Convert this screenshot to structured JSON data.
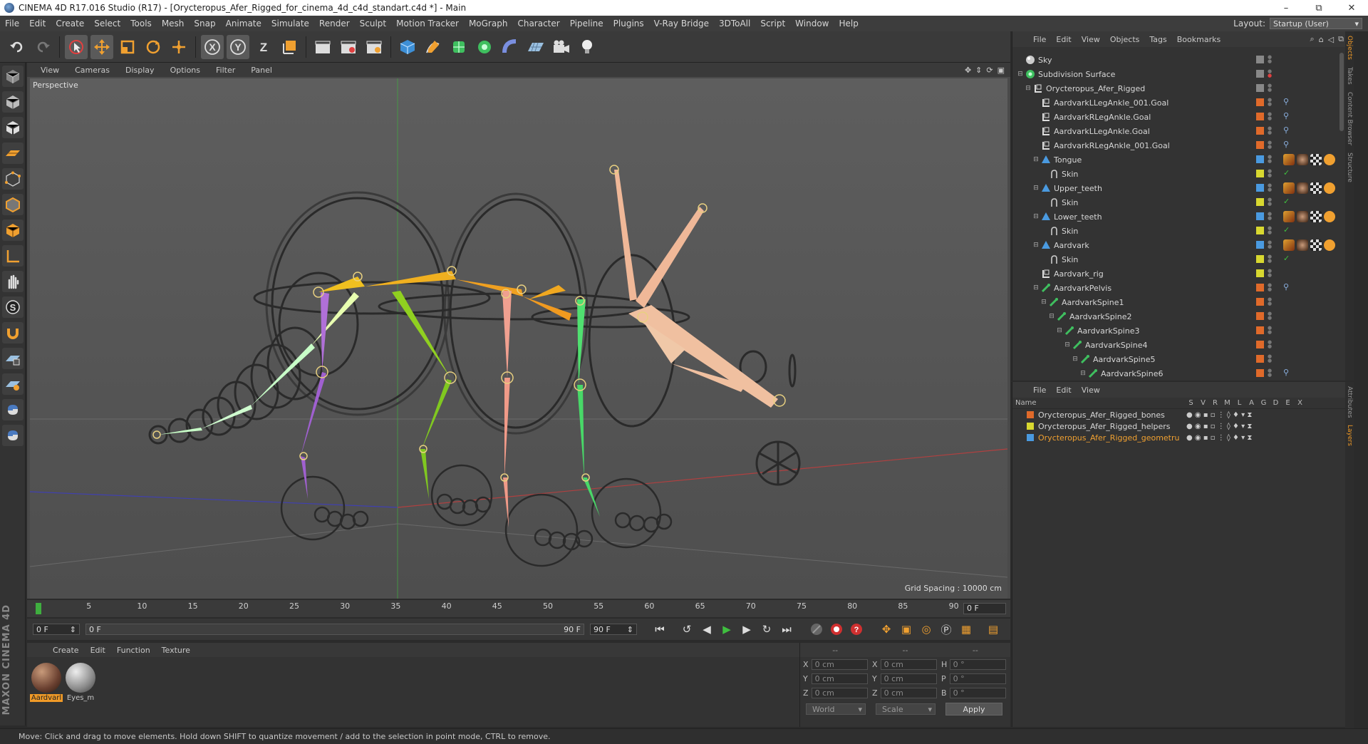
{
  "window": {
    "title": "CINEMA 4D R17.016 Studio (R17) - [Orycteropus_Afer_Rigged_for_cinema_4d_c4d_standart.c4d *] - Main",
    "minimize": "–",
    "maximize": "⧉",
    "close": "✕"
  },
  "menubar": {
    "items": [
      "File",
      "Edit",
      "Create",
      "Select",
      "Tools",
      "Mesh",
      "Snap",
      "Animate",
      "Simulate",
      "Render",
      "Sculpt",
      "Motion Tracker",
      "MoGraph",
      "Character",
      "Pipeline",
      "Plugins",
      "V-Ray Bridge",
      "3DToAll",
      "Script",
      "Window",
      "Help"
    ],
    "layout_label": "Layout:",
    "layout_value": "Startup (User)"
  },
  "viewport": {
    "menu": [
      "View",
      "Cameras",
      "Display",
      "Options",
      "Filter",
      "Panel"
    ],
    "label": "Perspective",
    "grid_spacing": "Grid Spacing : 10000 cm"
  },
  "timeline": {
    "ticks": [
      "0",
      "5",
      "10",
      "15",
      "20",
      "25",
      "30",
      "35",
      "40",
      "45",
      "50",
      "55",
      "60",
      "65",
      "70",
      "75",
      "80",
      "85",
      "90"
    ],
    "current_frame": "0 F"
  },
  "transport": {
    "start": "0 F",
    "range_start": "0 F",
    "range_end": "90 F",
    "end": "90 F"
  },
  "materials": {
    "menu": [
      "Create",
      "Edit",
      "Function",
      "Texture"
    ],
    "items": [
      {
        "name": "Aardvarl",
        "selected": true
      },
      {
        "name": "Eyes_m",
        "selected": false
      }
    ]
  },
  "coordinates": {
    "head": [
      "--",
      "--",
      "--"
    ],
    "rows": [
      {
        "a": "X",
        "av": "0 cm",
        "b": "X",
        "bv": "0 cm",
        "c": "H",
        "cv": "0 °"
      },
      {
        "a": "Y",
        "av": "0 cm",
        "b": "Y",
        "bv": "0 cm",
        "c": "P",
        "cv": "0 °"
      },
      {
        "a": "Z",
        "av": "0 cm",
        "b": "Z",
        "bv": "0 cm",
        "c": "B",
        "cv": "0 °"
      }
    ],
    "mode": "World",
    "type": "Scale",
    "apply": "Apply"
  },
  "status": "Move: Click and drag to move elements. Hold down SHIFT to quantize movement / add to the selection in point mode, CTRL to remove.",
  "object_manager": {
    "menu": [
      "File",
      "Edit",
      "View",
      "Objects",
      "Tags",
      "Bookmarks"
    ],
    "side_tabs": [
      "Objects",
      "Takes",
      "Content Browser",
      "Structure"
    ],
    "rows": [
      {
        "name": "Sky",
        "indent": 0,
        "twisty": "",
        "icon": "sky",
        "layer": "#888888"
      },
      {
        "name": "Subdivision Surface",
        "indent": 0,
        "twisty": "⊟",
        "icon": "subdiv",
        "layer": "#888888"
      },
      {
        "name": "Orycteropus_Afer_Rigged",
        "indent": 1,
        "twisty": "⊟",
        "icon": "null",
        "layer": "#888888"
      },
      {
        "name": "AardvarkLLegAnkle_001.Goal",
        "indent": 2,
        "twisty": "",
        "icon": "null",
        "layer": "#e06a2a"
      },
      {
        "name": "AardvarkRLegAnkle.Goal",
        "indent": 2,
        "twisty": "",
        "icon": "null",
        "layer": "#e06a2a"
      },
      {
        "name": "AardvarkLLegAnkle.Goal",
        "indent": 2,
        "twisty": "",
        "icon": "null",
        "layer": "#e06a2a"
      },
      {
        "name": "AardvarkRLegAnkle_001.Goal",
        "indent": 2,
        "twisty": "",
        "icon": "null",
        "layer": "#e06a2a"
      },
      {
        "name": "Tongue",
        "indent": 2,
        "twisty": "⊟",
        "icon": "mesh",
        "layer": "#4a9ae0"
      },
      {
        "name": "Skin",
        "indent": 3,
        "twisty": "",
        "icon": "skin",
        "layer": "#d8d830"
      },
      {
        "name": "Upper_teeth",
        "indent": 2,
        "twisty": "⊟",
        "icon": "mesh",
        "layer": "#4a9ae0"
      },
      {
        "name": "Skin",
        "indent": 3,
        "twisty": "",
        "icon": "skin",
        "layer": "#d8d830"
      },
      {
        "name": "Lower_teeth",
        "indent": 2,
        "twisty": "⊟",
        "icon": "mesh",
        "layer": "#4a9ae0"
      },
      {
        "name": "Skin",
        "indent": 3,
        "twisty": "",
        "icon": "skin",
        "layer": "#d8d830"
      },
      {
        "name": "Aardvark",
        "indent": 2,
        "twisty": "⊟",
        "icon": "mesh",
        "layer": "#4a9ae0"
      },
      {
        "name": "Skin",
        "indent": 3,
        "twisty": "",
        "icon": "skin",
        "layer": "#d8d830"
      },
      {
        "name": "Aardvark_rig",
        "indent": 2,
        "twisty": "",
        "icon": "null",
        "layer": "#d8d830"
      },
      {
        "name": "AardvarkPelvis",
        "indent": 2,
        "twisty": "⊟",
        "icon": "joint",
        "layer": "#e06a2a"
      },
      {
        "name": "AardvarkSpine1",
        "indent": 3,
        "twisty": "⊟",
        "icon": "joint",
        "layer": "#e06a2a"
      },
      {
        "name": "AardvarkSpine2",
        "indent": 4,
        "twisty": "⊟",
        "icon": "joint",
        "layer": "#e06a2a"
      },
      {
        "name": "AardvarkSpine3",
        "indent": 5,
        "twisty": "⊟",
        "icon": "joint",
        "layer": "#e06a2a"
      },
      {
        "name": "AardvarkSpine4",
        "indent": 6,
        "twisty": "⊟",
        "icon": "joint",
        "layer": "#e06a2a"
      },
      {
        "name": "AardvarkSpine5",
        "indent": 7,
        "twisty": "⊟",
        "icon": "joint",
        "layer": "#e06a2a"
      },
      {
        "name": "AardvarkSpine6",
        "indent": 8,
        "twisty": "⊟",
        "icon": "joint",
        "layer": "#e06a2a"
      }
    ]
  },
  "layer_manager": {
    "menu": [
      "File",
      "Edit",
      "View"
    ],
    "side_tabs": [
      "Attributes",
      "Layers"
    ],
    "header": {
      "name": "Name",
      "cols": [
        "S",
        "V",
        "R",
        "M",
        "L",
        "A",
        "G",
        "D",
        "E",
        "X"
      ]
    },
    "rows": [
      {
        "name": "Orycteropus_Afer_Rigged_bones",
        "color": "#e06a2a",
        "highlight": false
      },
      {
        "name": "Orycteropus_Afer_Rigged_helpers",
        "color": "#d8d830",
        "highlight": false
      },
      {
        "name": "Orycteropus_Afer_Rigged_geometru",
        "color": "#4a9ae0",
        "highlight": true
      }
    ]
  },
  "brand": "MAXON CINEMA 4D"
}
